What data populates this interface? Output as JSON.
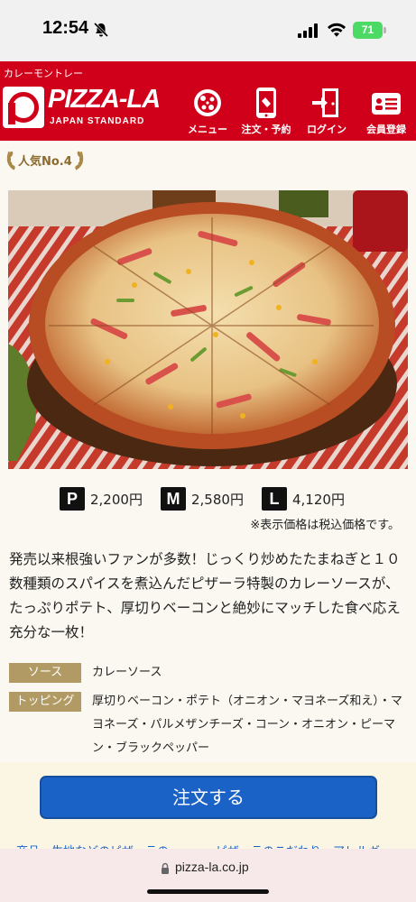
{
  "status_bar": {
    "time": "12:54",
    "battery": "71",
    "icons": [
      "bell-slash-icon",
      "signal-icon",
      "wifi-icon",
      "battery-icon"
    ]
  },
  "header": {
    "caption": "カレーモントレー",
    "logo_text": "PIZZA-LA",
    "logo_subtext": "JAPAN STANDARD",
    "nav": [
      {
        "label": "メニュー",
        "icon": "pizza-icon"
      },
      {
        "label": "注文・予約",
        "icon": "phone-order-icon"
      },
      {
        "label": "ログイン",
        "icon": "door-login-icon"
      },
      {
        "label": "会員登録",
        "icon": "member-card-icon"
      }
    ],
    "colors": {
      "brand_red": "#d0001a"
    }
  },
  "ranking": {
    "label": "人気No.4",
    "icon": "laurel-icon"
  },
  "product": {
    "image_alt": "curry-pizza-photo",
    "prices": [
      {
        "size": "P",
        "price": "2,200円"
      },
      {
        "size": "M",
        "price": "2,580円"
      },
      {
        "size": "L",
        "price": "4,120円"
      }
    ],
    "tax_note": "※表示価格は税込価格です。",
    "description": "発売以来根強いファンが多数！じっくり炒めたたまねぎと１０数種類のスパイスを煮込んだピザーラ特製のカレーソースが、たっぷりポテト、厚切りベーコンと絶妙にマッチした食べ応え充分な一枚！",
    "sauce_label": "ソース",
    "sauce_value": "カレーソース",
    "topping_label": "トッピング",
    "topping_value": "厚切りベーコン・ポテト（オニオン・マヨネーズ和え）・マヨネーズ・パルメザンチーズ・コーン・オニオン・ピーマン・ブラックペッパー"
  },
  "order": {
    "button_label": "注文する",
    "colors": {
      "button": "#1b62c6"
    }
  },
  "next_section_text": "商品・生地などのピザーラの…………ピザーラのこだわり…アレルギー",
  "browser": {
    "url": "pizza-la.co.jp"
  }
}
